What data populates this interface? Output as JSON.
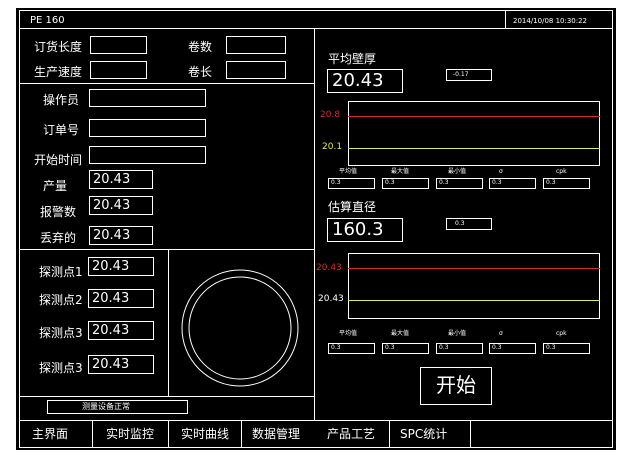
{
  "header": {
    "title": "PE 160",
    "datetime": "2014/10/08 10:30:22"
  },
  "left": {
    "order_length_label": "订货长度",
    "coil_count_label": "卷数",
    "production_speed_label": "生产速度",
    "coil_length_label": "卷长",
    "operator_label": "操作员",
    "order_no_label": "订单号",
    "start_time_label": "开始时间",
    "output_label": "产量",
    "output_value": "20.43",
    "alarm_count_label": "报警数",
    "alarm_count_value": "20.43",
    "discarded_label": "丢弃的",
    "discarded_value": "20.43",
    "probes": [
      {
        "label": "探测点1",
        "value": "20.43"
      },
      {
        "label": "探测点2",
        "value": "20.43"
      },
      {
        "label": "探测点3",
        "value": "20.43"
      },
      {
        "label": "探测点3",
        "value": "20.43"
      }
    ],
    "status": "测量设备正常"
  },
  "wall": {
    "title": "平均壁厚",
    "value": "20.43",
    "delta": "-0.17",
    "upper": "20.8",
    "lower": "20.1",
    "stats_labels": [
      "平均值",
      "最大值",
      "最小值",
      "σ",
      "cpk"
    ],
    "stats_values": [
      "0.3",
      "0.3",
      "0.3",
      "0.3",
      "0.3"
    ]
  },
  "diameter": {
    "title": "估算直径",
    "value": "160.3",
    "delta": "0.3",
    "upper": "20.43",
    "lower": "20.43",
    "stats_labels": [
      "平均值",
      "最大值",
      "最小值",
      "σ",
      "cpk"
    ],
    "stats_values": [
      "0.3",
      "0.3",
      "0.3",
      "0.3",
      "0.3"
    ]
  },
  "start_button": "开始",
  "colors": {
    "background": "#000000",
    "foreground": "#ffffff",
    "upper_limit": "#d42a2a",
    "lower_limit": "#e6e65a"
  },
  "nav": [
    "主界面",
    "实时监控",
    "实时曲线",
    "数据管理",
    "产品工艺",
    "SPC统计"
  ]
}
